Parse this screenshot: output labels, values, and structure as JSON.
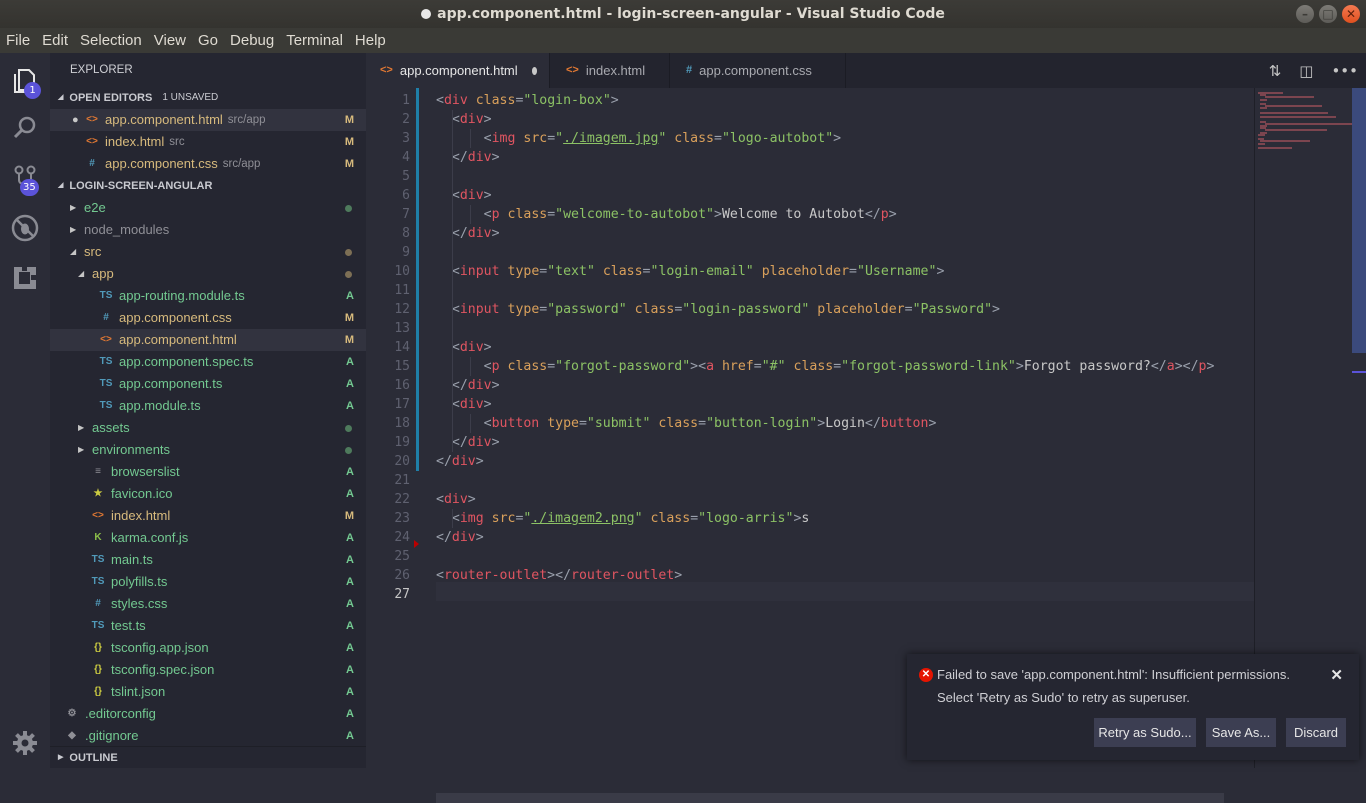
{
  "window": {
    "title": "app.component.html - login-screen-angular - Visual Studio Code",
    "controls": [
      "minimize",
      "maximize",
      "close"
    ]
  },
  "menu": [
    "File",
    "Edit",
    "Selection",
    "View",
    "Go",
    "Debug",
    "Terminal",
    "Help"
  ],
  "activity_bar": {
    "explorer_badge": "1",
    "scm_badge": "35"
  },
  "explorer": {
    "title": "EXPLORER",
    "open_editors": {
      "label": "OPEN EDITORS",
      "unsaved": "1 UNSAVED",
      "items": [
        {
          "name": "app.component.html",
          "desc": "src/app",
          "icon": "<>",
          "status": "M",
          "dirty": true
        },
        {
          "name": "index.html",
          "desc": "src",
          "icon": "<>",
          "status": "M",
          "dirty": false
        },
        {
          "name": "app.component.css",
          "desc": "src/app",
          "icon": "#",
          "status": "M",
          "dirty": false
        }
      ]
    },
    "project": {
      "label": "LOGIN-SCREEN-ANGULAR",
      "tree": [
        {
          "name": "e2e",
          "type": "folder",
          "expanded": false,
          "status": "dot-green"
        },
        {
          "name": "node_modules",
          "type": "folder",
          "expanded": false,
          "status": ""
        },
        {
          "name": "src",
          "type": "folder",
          "expanded": true,
          "status": "dot-yellow"
        },
        {
          "name": "app",
          "type": "folder",
          "expanded": true,
          "status": "dot-yellow"
        },
        {
          "name": "app-routing.module.ts",
          "icon": "TS",
          "status": "A"
        },
        {
          "name": "app.component.css",
          "icon": "#",
          "status": "M"
        },
        {
          "name": "app.component.html",
          "icon": "<>",
          "status": "M",
          "selected": true
        },
        {
          "name": "app.component.spec.ts",
          "icon": "TS",
          "status": "A"
        },
        {
          "name": "app.component.ts",
          "icon": "TS",
          "status": "A"
        },
        {
          "name": "app.module.ts",
          "icon": "TS",
          "status": "A"
        },
        {
          "name": "assets",
          "type": "folder",
          "expanded": false,
          "status": "dot-green"
        },
        {
          "name": "environments",
          "type": "folder",
          "expanded": false,
          "status": "dot-green"
        },
        {
          "name": "browserslist",
          "icon": "≡",
          "status": "A"
        },
        {
          "name": "favicon.ico",
          "icon": "★",
          "status": "A"
        },
        {
          "name": "index.html",
          "icon": "<>",
          "status": "M"
        },
        {
          "name": "karma.conf.js",
          "icon": "K",
          "status": "A"
        },
        {
          "name": "main.ts",
          "icon": "TS",
          "status": "A"
        },
        {
          "name": "polyfills.ts",
          "icon": "TS",
          "status": "A"
        },
        {
          "name": "styles.css",
          "icon": "#",
          "status": "A"
        },
        {
          "name": "test.ts",
          "icon": "TS",
          "status": "A"
        },
        {
          "name": "tsconfig.app.json",
          "icon": "{}",
          "status": "A"
        },
        {
          "name": "tsconfig.spec.json",
          "icon": "{}",
          "status": "A"
        },
        {
          "name": "tslint.json",
          "icon": "{}",
          "status": "A"
        },
        {
          "name": ".editorconfig",
          "icon": "⚙",
          "status": "A"
        },
        {
          "name": ".gitignore",
          "icon": "◆",
          "status": "A"
        }
      ]
    },
    "outline_label": "OUTLINE"
  },
  "tabs": [
    {
      "label": "app.component.html",
      "icon": "<>",
      "active": true,
      "dirty": true
    },
    {
      "label": "index.html",
      "icon": "<>",
      "active": false,
      "dirty": false
    },
    {
      "label": "app.component.css",
      "icon": "#",
      "active": false,
      "dirty": false
    }
  ],
  "editor": {
    "line_numbers": [
      "1",
      "2",
      "3",
      "4",
      "5",
      "6",
      "7",
      "8",
      "9",
      "10",
      "11",
      "12",
      "13",
      "14",
      "15",
      "16",
      "17",
      "18",
      "19",
      "20",
      "21",
      "22",
      "23",
      "24",
      "25",
      "26",
      "27"
    ],
    "lines": [
      "<div class=\"login-box\">",
      "  <div>",
      "      <img src=\"./imagem.jpg\" class=\"logo-autobot\">",
      "  </div>",
      "",
      "  <div>",
      "      <p class=\"welcome-to-autobot\">Welcome to Autobot</p>",
      "  </div>",
      "",
      "  <input type=\"text\" class=\"login-email\" placeholder=\"Username\">",
      "",
      "  <input type=\"password\" class=\"login-password\" placeholder=\"Password\">",
      "",
      "  <div>",
      "      <p class=\"forgot-password\"><a href=\"#\" class=\"forgot-password-link\">Forgot password?</a></p>",
      "  </div>",
      "  <div>",
      "      <button type=\"submit\" class=\"button-login\">Login</button>",
      "  </div>",
      "</div>",
      "",
      "<div>",
      "  <img src=\"./imagem2.png\" class=\"logo-arris\">s",
      "</div>",
      "",
      "<router-outlet></router-outlet>",
      ""
    ]
  },
  "notification": {
    "message": "Failed to save 'app.component.html': Insufficient permissions.",
    "detail": "Select 'Retry as Sudo' to retry as superuser.",
    "buttons": [
      "Retry as Sudo...",
      "Save As...",
      "Discard"
    ]
  },
  "colors": {
    "accent": "#5b53d9",
    "modified": "#d7ba7d",
    "added": "#73c991",
    "error": "#e51400"
  }
}
